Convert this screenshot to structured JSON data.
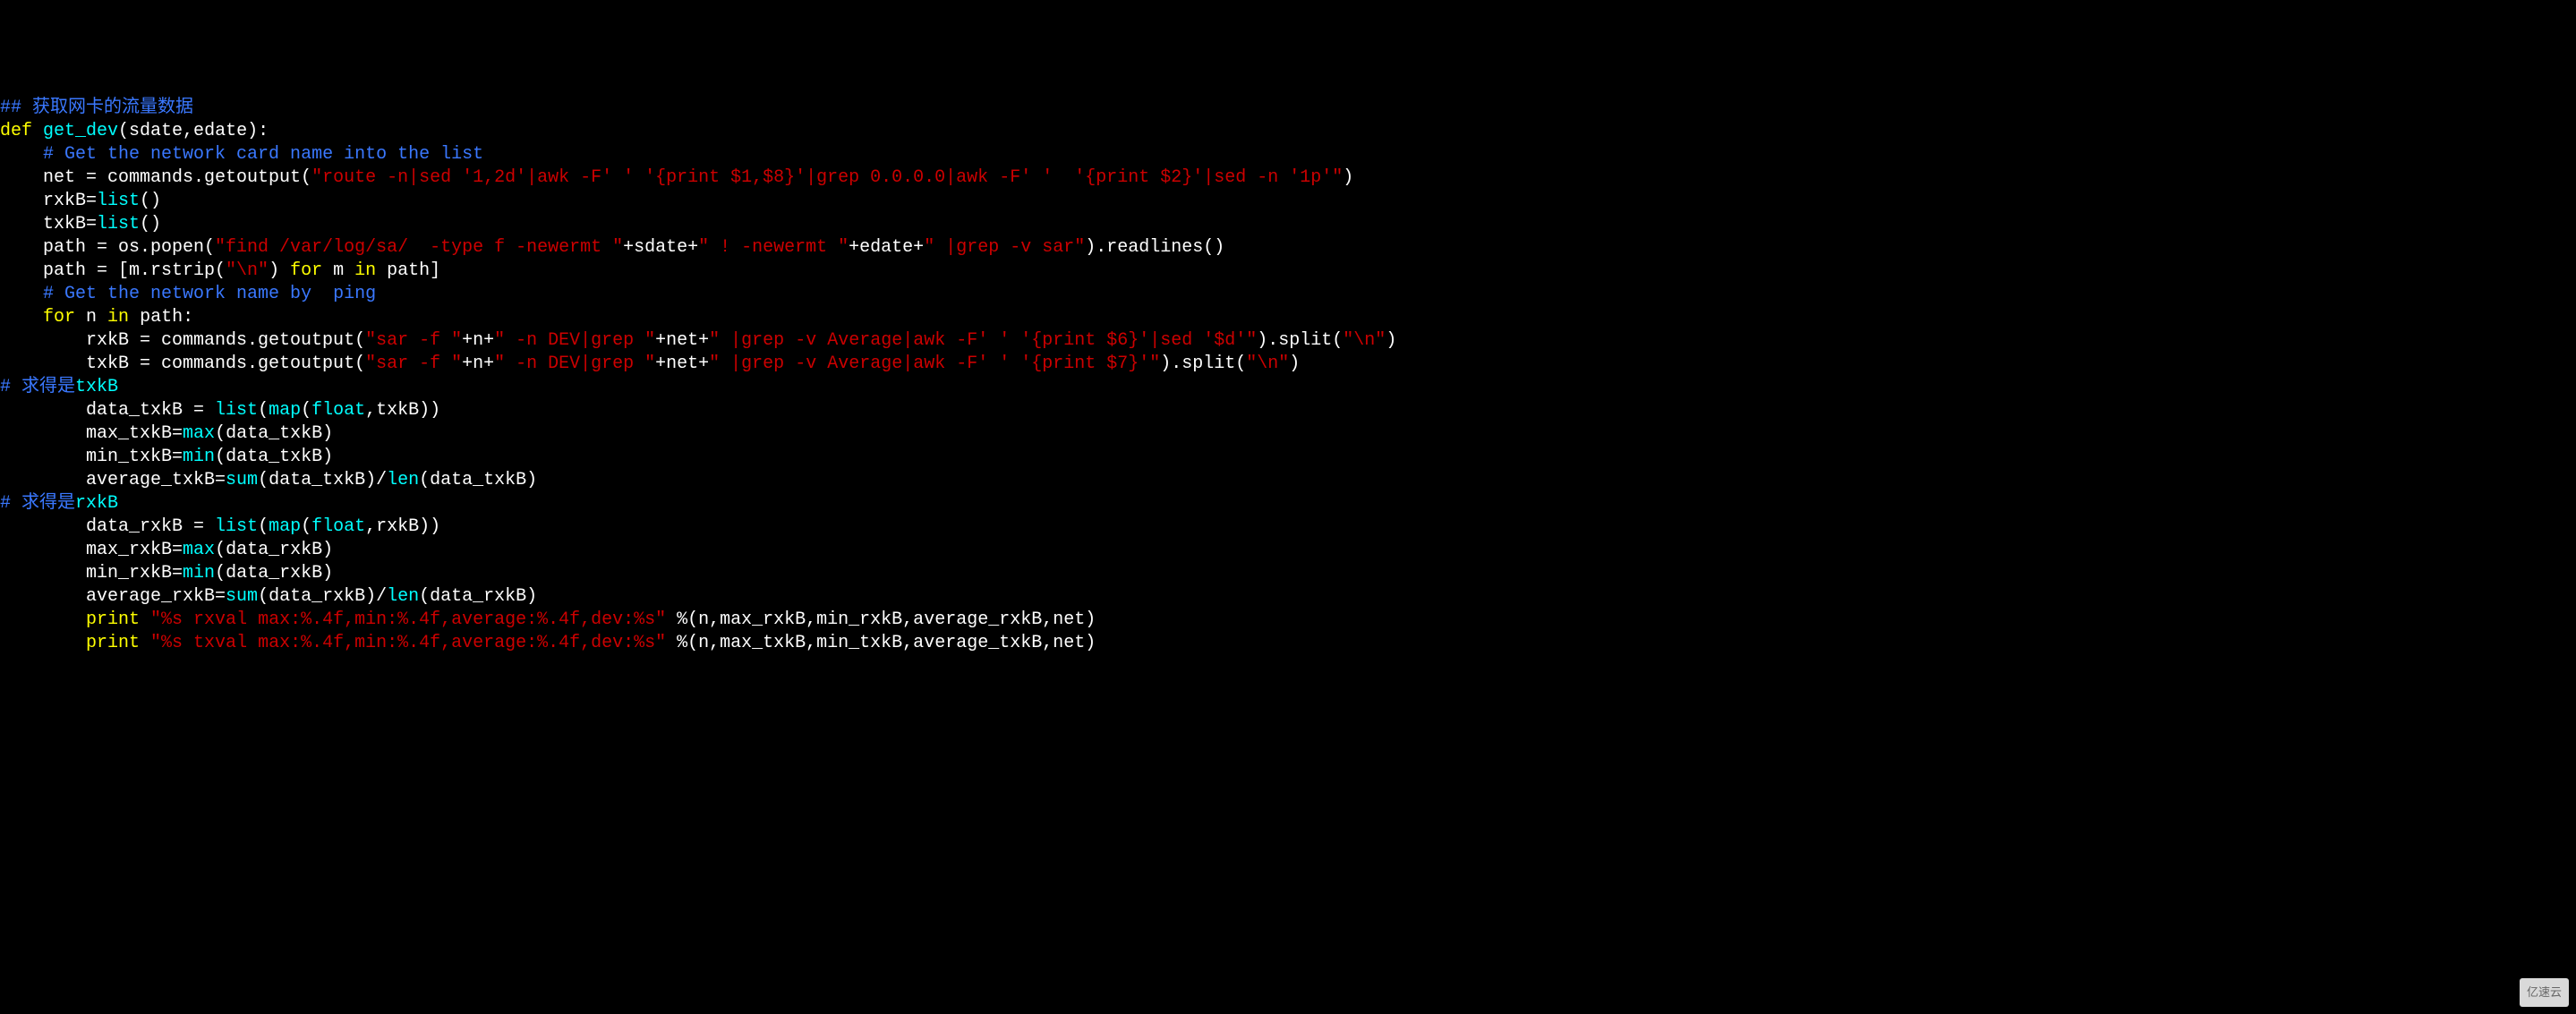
{
  "watermark": "亿速云",
  "lines": [
    [
      {
        "cls": "c-comment",
        "t": "## 获取网卡的流量数据"
      }
    ],
    [
      {
        "cls": "c-keyword",
        "t": "def"
      },
      {
        "cls": "c-white",
        "t": " "
      },
      {
        "cls": "c-funcdef",
        "t": "get_dev"
      },
      {
        "cls": "c-white",
        "t": "(sdate,edate):"
      }
    ],
    [
      {
        "cls": "c-white",
        "t": "    "
      },
      {
        "cls": "c-comment",
        "t": "# Get the network card name into the list"
      }
    ],
    [
      {
        "cls": "c-white",
        "t": "    net = commands.getoutput("
      },
      {
        "cls": "c-string",
        "t": "\"route -n|sed '1,2d'|awk -F' ' '{print $1,$8}'|grep 0.0.0.0|awk -F' '  '{print $2}'|sed -n '1p'\""
      },
      {
        "cls": "c-white",
        "t": ")"
      }
    ],
    [
      {
        "cls": "c-white",
        "t": "    rxkB="
      },
      {
        "cls": "c-builtin",
        "t": "list"
      },
      {
        "cls": "c-white",
        "t": "()"
      }
    ],
    [
      {
        "cls": "c-white",
        "t": "    txkB="
      },
      {
        "cls": "c-builtin",
        "t": "list"
      },
      {
        "cls": "c-white",
        "t": "()"
      }
    ],
    [
      {
        "cls": "c-white",
        "t": "    path = os.popen("
      },
      {
        "cls": "c-string",
        "t": "\"find /var/log/sa/  -type f -newermt \""
      },
      {
        "cls": "c-white",
        "t": "+sdate+"
      },
      {
        "cls": "c-string",
        "t": "\" ! -newermt \""
      },
      {
        "cls": "c-white",
        "t": "+edate+"
      },
      {
        "cls": "c-string",
        "t": "\" |grep -v sar\""
      },
      {
        "cls": "c-white",
        "t": ").readlines()"
      }
    ],
    [
      {
        "cls": "c-white",
        "t": "    path = [m.rstrip("
      },
      {
        "cls": "c-string",
        "t": "\"\\n\""
      },
      {
        "cls": "c-white",
        "t": ") "
      },
      {
        "cls": "c-keyword",
        "t": "for"
      },
      {
        "cls": "c-white",
        "t": " m "
      },
      {
        "cls": "c-keyword",
        "t": "in"
      },
      {
        "cls": "c-white",
        "t": " path]"
      }
    ],
    [
      {
        "cls": "c-white",
        "t": "    "
      },
      {
        "cls": "c-comment",
        "t": "# Get the network name by  ping"
      }
    ],
    [
      {
        "cls": "c-white",
        "t": "    "
      },
      {
        "cls": "c-keyword",
        "t": "for"
      },
      {
        "cls": "c-white",
        "t": " n "
      },
      {
        "cls": "c-keyword",
        "t": "in"
      },
      {
        "cls": "c-white",
        "t": " path:"
      }
    ],
    [
      {
        "cls": "c-white",
        "t": "        rxkB = commands.getoutput("
      },
      {
        "cls": "c-string",
        "t": "\"sar -f \""
      },
      {
        "cls": "c-white",
        "t": "+n+"
      },
      {
        "cls": "c-string",
        "t": "\" -n DEV|grep \""
      },
      {
        "cls": "c-white",
        "t": "+net+"
      },
      {
        "cls": "c-string",
        "t": "\" |grep -v Average|awk -F' ' '{print $6}'|sed '$d'\""
      },
      {
        "cls": "c-white",
        "t": ").split("
      },
      {
        "cls": "c-string",
        "t": "\"\\n\""
      },
      {
        "cls": "c-white",
        "t": ")"
      }
    ],
    [
      {
        "cls": "c-white",
        "t": "        txkB = commands.getoutput("
      },
      {
        "cls": "c-string",
        "t": "\"sar -f \""
      },
      {
        "cls": "c-white",
        "t": "+n+"
      },
      {
        "cls": "c-string",
        "t": "\" -n DEV|grep \""
      },
      {
        "cls": "c-white",
        "t": "+net+"
      },
      {
        "cls": "c-string",
        "t": "\" |grep -v Average|awk -F' ' '{print $7}'\""
      },
      {
        "cls": "c-white",
        "t": ").split("
      },
      {
        "cls": "c-string",
        "t": "\"\\n\""
      },
      {
        "cls": "c-white",
        "t": ")"
      }
    ],
    [
      {
        "cls": "c-comment",
        "t": "# 求得是"
      },
      {
        "cls": "c-funcdef",
        "t": "txkB"
      }
    ],
    [
      {
        "cls": "c-white",
        "t": "        data_txkB = "
      },
      {
        "cls": "c-builtin",
        "t": "list"
      },
      {
        "cls": "c-white",
        "t": "("
      },
      {
        "cls": "c-builtin",
        "t": "map"
      },
      {
        "cls": "c-white",
        "t": "("
      },
      {
        "cls": "c-builtin",
        "t": "float"
      },
      {
        "cls": "c-white",
        "t": ",txkB))"
      }
    ],
    [
      {
        "cls": "c-white",
        "t": "        max_txkB="
      },
      {
        "cls": "c-builtin",
        "t": "max"
      },
      {
        "cls": "c-white",
        "t": "(data_txkB)"
      }
    ],
    [
      {
        "cls": "c-white",
        "t": "        min_txkB="
      },
      {
        "cls": "c-builtin",
        "t": "min"
      },
      {
        "cls": "c-white",
        "t": "(data_txkB)"
      }
    ],
    [
      {
        "cls": "c-white",
        "t": "        average_txkB="
      },
      {
        "cls": "c-builtin",
        "t": "sum"
      },
      {
        "cls": "c-white",
        "t": "(data_txkB)/"
      },
      {
        "cls": "c-builtin",
        "t": "len"
      },
      {
        "cls": "c-white",
        "t": "(data_txkB)"
      }
    ],
    [
      {
        "cls": "c-comment",
        "t": "# 求得是"
      },
      {
        "cls": "c-funcdef",
        "t": "rxkB"
      }
    ],
    [
      {
        "cls": "c-white",
        "t": "        data_rxkB = "
      },
      {
        "cls": "c-builtin",
        "t": "list"
      },
      {
        "cls": "c-white",
        "t": "("
      },
      {
        "cls": "c-builtin",
        "t": "map"
      },
      {
        "cls": "c-white",
        "t": "("
      },
      {
        "cls": "c-builtin",
        "t": "float"
      },
      {
        "cls": "c-white",
        "t": ",rxkB))"
      }
    ],
    [
      {
        "cls": "c-white",
        "t": "        max_rxkB="
      },
      {
        "cls": "c-builtin",
        "t": "max"
      },
      {
        "cls": "c-white",
        "t": "(data_rxkB)"
      }
    ],
    [
      {
        "cls": "c-white",
        "t": "        min_rxkB="
      },
      {
        "cls": "c-builtin",
        "t": "min"
      },
      {
        "cls": "c-white",
        "t": "(data_rxkB)"
      }
    ],
    [
      {
        "cls": "c-white",
        "t": "        average_rxkB="
      },
      {
        "cls": "c-builtin",
        "t": "sum"
      },
      {
        "cls": "c-white",
        "t": "(data_rxkB)/"
      },
      {
        "cls": "c-builtin",
        "t": "len"
      },
      {
        "cls": "c-white",
        "t": "(data_rxkB)"
      }
    ],
    [
      {
        "cls": "c-white",
        "t": "        "
      },
      {
        "cls": "c-keyword",
        "t": "print"
      },
      {
        "cls": "c-white",
        "t": " "
      },
      {
        "cls": "c-string",
        "t": "\"%s rxval max:%.4f,min:%.4f,average:%.4f,dev:%s\""
      },
      {
        "cls": "c-white",
        "t": " %(n,max_rxkB,min_rxkB,average_rxkB,net)"
      }
    ],
    [
      {
        "cls": "c-white",
        "t": "        "
      },
      {
        "cls": "c-keyword",
        "t": "print"
      },
      {
        "cls": "c-white",
        "t": " "
      },
      {
        "cls": "c-string",
        "t": "\"%s txval max:%.4f,min:%.4f,average:%.4f,dev:%s\""
      },
      {
        "cls": "c-white",
        "t": " %(n,max_txkB,min_txkB,average_txkB,net)"
      }
    ]
  ]
}
